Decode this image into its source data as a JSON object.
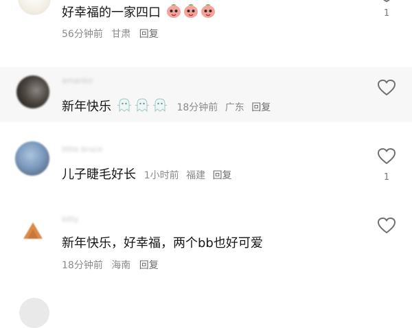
{
  "comments": [
    {
      "username": "",
      "text": "好幸福的一家四口",
      "emoji_icon": "peach-face-emoji",
      "time": "56分钟前",
      "location": "甘肃",
      "reply_label": "回复",
      "like_count": "1"
    },
    {
      "username": "amanbo",
      "text": "新年快乐",
      "emoji_icon": "ghost-emoji",
      "time": "18分钟前",
      "location": "广东",
      "reply_label": "回复",
      "like_count": ""
    },
    {
      "username": "little bruce",
      "text": "儿子睫毛好长",
      "time": "1小时前",
      "location": "福建",
      "reply_label": "回复",
      "like_count": "1"
    },
    {
      "username": "kitty",
      "text": "新年快乐，好幸福，两个bb也好可爱",
      "time": "18分钟前",
      "location": "海南",
      "reply_label": "回复",
      "like_count": ""
    }
  ],
  "colors": {
    "highlight_row": "#f7f7f7",
    "text": "#161616",
    "meta": "#8a8a8a"
  }
}
